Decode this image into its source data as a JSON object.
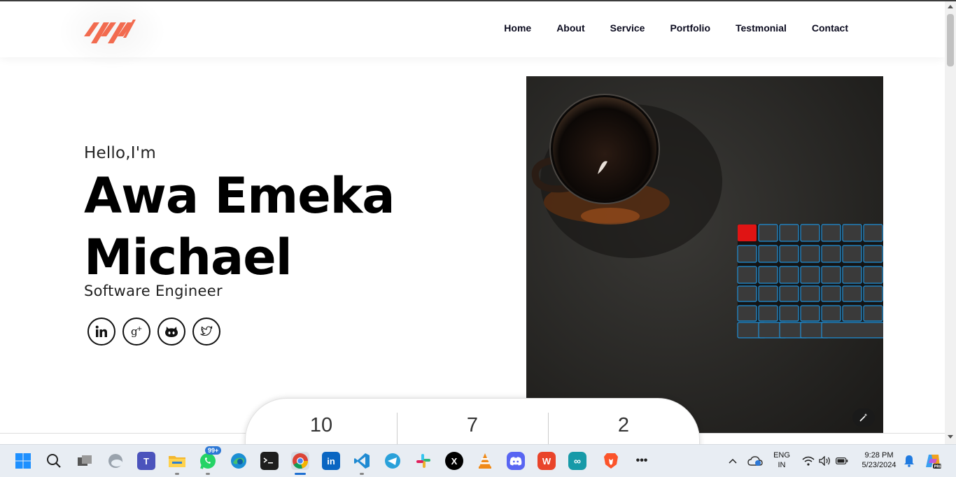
{
  "nav": {
    "items": [
      {
        "label": "Home"
      },
      {
        "label": "About"
      },
      {
        "label": "Service"
      },
      {
        "label": "Portfolio"
      },
      {
        "label": "Testmonial"
      },
      {
        "label": "Contact"
      }
    ]
  },
  "hero": {
    "greeting": "Hello,I'm",
    "name_line1": "Awa Emeka",
    "name_line2": "Michael",
    "role": "Software Engineer",
    "socials": [
      "linkedin-icon",
      "google-plus-icon",
      "github-icon",
      "twitter-icon"
    ]
  },
  "stats": [
    {
      "value": "10"
    },
    {
      "value": "7"
    },
    {
      "value": "2"
    }
  ],
  "colors": {
    "accent": "#f26b4f",
    "text": "#000000"
  },
  "taskbar": {
    "whatsapp_badge": "99+",
    "lang_line1": "ENG",
    "lang_line2": "IN",
    "time": "9:28 PM",
    "date": "5/23/2024"
  }
}
